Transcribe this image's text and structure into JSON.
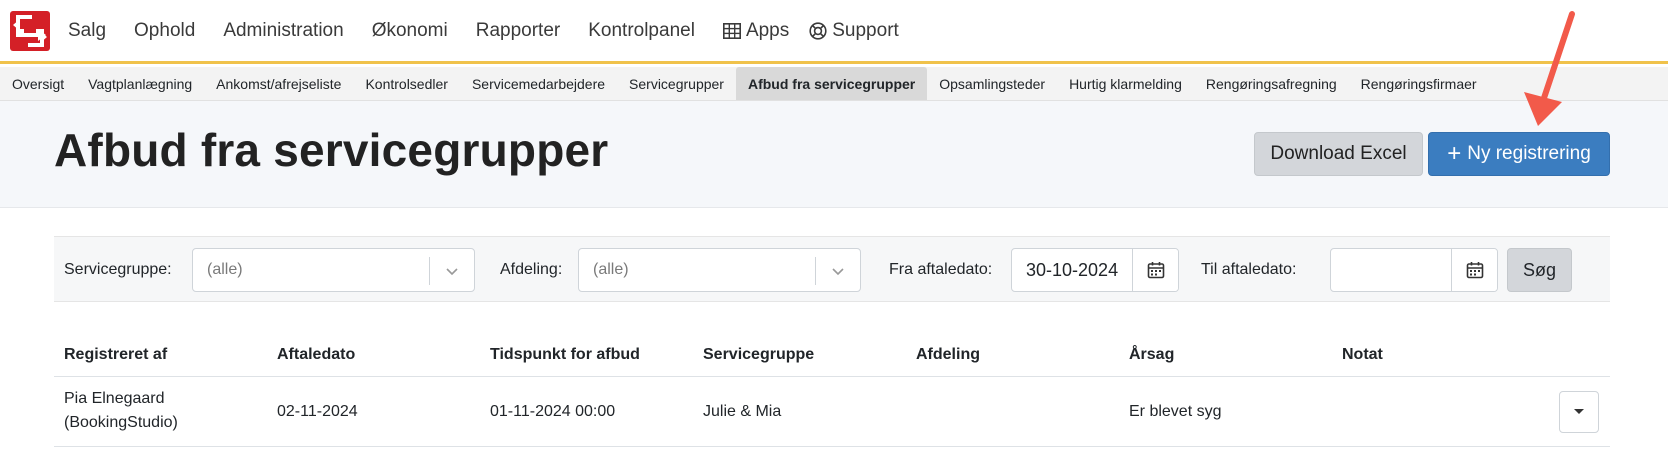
{
  "topnav": {
    "items": [
      {
        "label": "Salg"
      },
      {
        "label": "Ophold"
      },
      {
        "label": "Administration"
      },
      {
        "label": "Økonomi"
      },
      {
        "label": "Rapporter"
      },
      {
        "label": "Kontrolpanel"
      },
      {
        "label": "Apps",
        "icon": "grid-icon"
      },
      {
        "label": "Support",
        "icon": "lifebuoy-icon"
      }
    ]
  },
  "subnav": {
    "items": [
      {
        "label": "Oversigt"
      },
      {
        "label": "Vagtplanlægning"
      },
      {
        "label": "Ankomst/afrejseliste"
      },
      {
        "label": "Kontrolsedler"
      },
      {
        "label": "Servicemedarbejdere"
      },
      {
        "label": "Servicegrupper"
      },
      {
        "label": "Afbud fra servicegrupper",
        "active": true
      },
      {
        "label": "Opsamlingsteder"
      },
      {
        "label": "Hurtig klarmelding"
      },
      {
        "label": "Rengøringsafregning"
      },
      {
        "label": "Rengøringsfirmaer"
      }
    ]
  },
  "header": {
    "title": "Afbud fra servicegrupper",
    "download_label": "Download Excel",
    "new_label": "Ny registrering"
  },
  "filters": {
    "servicegruppe_label": "Servicegruppe:",
    "servicegruppe_value": "(alle)",
    "afdeling_label": "Afdeling:",
    "afdeling_value": "(alle)",
    "fra_label": "Fra aftaledato:",
    "fra_value": "30-10-2024",
    "til_label": "Til aftaledato:",
    "til_value": "",
    "search_label": "Søg"
  },
  "table": {
    "columns": [
      "Registreret af",
      "Aftaledato",
      "Tidspunkt for afbud",
      "Servicegruppe",
      "Afdeling",
      "Årsag",
      "Notat"
    ],
    "rows": [
      {
        "registreret_af_line1": "Pia Elnegaard",
        "registreret_af_line2": "(BookingStudio)",
        "aftaledato": "02-11-2024",
        "tidspunkt": "01-11-2024 00:00",
        "servicegruppe": "Julie & Mia",
        "afdeling": "",
        "aarsag": "Er blevet syg",
        "notat": ""
      }
    ]
  },
  "colors": {
    "brand_red": "#d42027",
    "accent_yellow": "#f0c24b",
    "primary_blue": "#3b7dc0",
    "annotation_arrow": "#f25a4a"
  }
}
